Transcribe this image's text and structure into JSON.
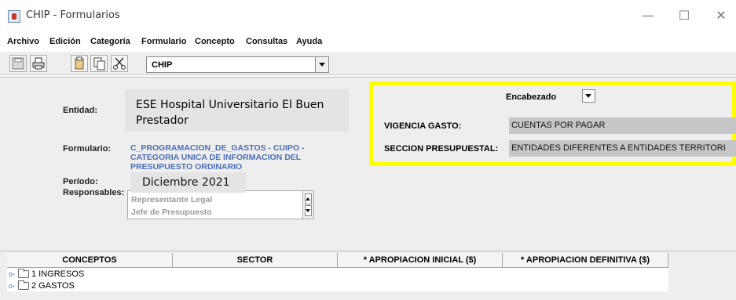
{
  "window": {
    "title": "CHIP - Formularios",
    "minimize": "—",
    "maximize": "☐",
    "close": "✕"
  },
  "menu": [
    "Archivo",
    "Edición",
    "Categoría",
    "Formulario",
    "Concepto",
    "Consultas",
    "Ayuda"
  ],
  "toolbar": {
    "combo_value": "CHIP",
    "icons": [
      "save-icon",
      "print-icon",
      "paste-icon",
      "copy-icon",
      "cut-icon"
    ]
  },
  "form": {
    "entidad_label": "Entidad:",
    "entidad_value": "ESE Hospital Universitario El Buen Prestador",
    "formulario_label": "Formulario:",
    "formulario_value": "C_PROGRAMACION_DE_GASTOS - CUIPO - CATEGORIA UNICA DE INFORMACION DEL PRESUPUESTO ORDINARIO",
    "periodo_label": "Período:",
    "periodo_value": "Diciembre 2021",
    "responsables_label": "Responsables:",
    "responsables": [
      "Representante Legal",
      "Jefe de Presupuesto"
    ]
  },
  "header_panel": {
    "encabezado_label": "Encabezado",
    "vigencia_label": "VIGENCIA GASTO:",
    "vigencia_value": "CUENTAS POR PAGAR",
    "seccion_label": "SECCION PRESUPUESTAL:",
    "seccion_value": "ENTIDADES DIFERENTES A ENTIDADES TERRITORI",
    "highlight_color": "#ffff00"
  },
  "grid": {
    "columns": [
      "CONCEPTOS",
      "SECTOR",
      "* APROPIACION INICIAL ($)",
      "* APROPIACION DEFINITIVA ($)"
    ],
    "rows": [
      "1 INGRESOS",
      "2 GASTOS"
    ]
  }
}
